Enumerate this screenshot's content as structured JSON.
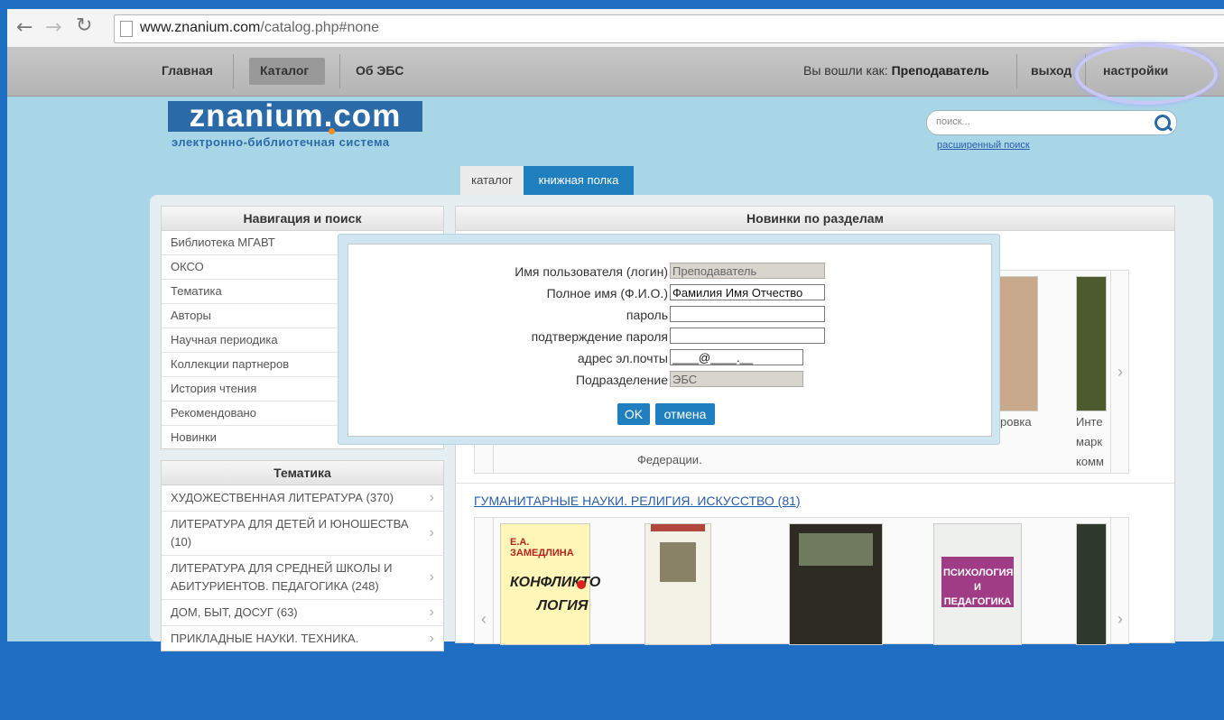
{
  "browser": {
    "url_host": "www.znanium.com",
    "url_path": "/catalog.php#none",
    "back_icon": "arrow-left-icon",
    "forward_icon": "arrow-right-icon",
    "reload_icon": "reload-icon"
  },
  "topnav": {
    "home": "Главная",
    "catalog": "Каталог",
    "about": "Об ЭБС",
    "logged_prefix": "Вы вошли как:",
    "logged_user": "Преподаватель",
    "logout": "выход",
    "settings": "настройки"
  },
  "logo": {
    "name": "znanium.com",
    "subtitle": "электронно-библиотечная система"
  },
  "search": {
    "placeholder": "поиск...",
    "advanced": "расширенный поиск"
  },
  "tabs": {
    "catalog": "каталог",
    "shelf": "книжная полка"
  },
  "nav_panel": {
    "title": "Навигация и поиск",
    "items": [
      "Библиотека МГАВТ",
      "ОКСО",
      "Тематика",
      "Авторы",
      "Научная периодика",
      "Коллекции партнеров",
      "История чтения",
      "Рекомендовано",
      "Новинки"
    ]
  },
  "themes_panel": {
    "title": "Тематика",
    "items": [
      "ХУДОЖЕСТВЕННАЯ ЛИТЕРАТУРА (370)",
      "ЛИТЕРАТУРА ДЛЯ ДЕТЕЙ И ЮНОШЕСТВА (10)",
      "ЛИТЕРАТУРА ДЛЯ СРЕДНЕЙ ШКОЛЫ И АБИТУРИЕНТОВ. ПЕДАГОГИКА (248)",
      "ДОМ, БЫТ, ДОСУГ (63)",
      "ПРИКЛАДНЫЕ НАУКИ. ТЕХНИКА."
    ]
  },
  "news_panel": {
    "title": "Новинки по разделам",
    "partial_texts": [
      "Федерации.",
      "ровка",
      "Инте",
      "марк",
      "комм"
    ],
    "section_link": "ГУМАНИТАРНЫЕ НАУКИ. РЕЛИГИЯ. ИСКУССТВО (81)",
    "book_cover_texts": [
      "Е.А. ЗАМЕДЛИНА",
      "КОНФЛИКТО",
      "ЛОГИЯ",
      "ПСИХОЛОГИЯ И ПЕДАГОГИКА"
    ]
  },
  "dialog": {
    "fields": [
      {
        "label": "Имя пользователя (логин)",
        "value": "Преподаватель",
        "readonly": true
      },
      {
        "label": "Полное имя (Ф.И.О.)",
        "value": "Фамилия Имя Отчество",
        "readonly": false
      },
      {
        "label": "пароль",
        "value": "",
        "readonly": false
      },
      {
        "label": "подтверждение пароля",
        "value": "",
        "readonly": false
      },
      {
        "label": "адрес эл.почты",
        "value": "____@____.__",
        "readonly": false
      },
      {
        "label": "Подразделение",
        "value": "ЭБС",
        "readonly": true
      }
    ],
    "ok": "OK",
    "cancel": "отмена"
  },
  "colors": {
    "accent": "#1f7fbf",
    "page_bg": "#a9d6e6",
    "highlight_ring": "#c8c8f6"
  }
}
